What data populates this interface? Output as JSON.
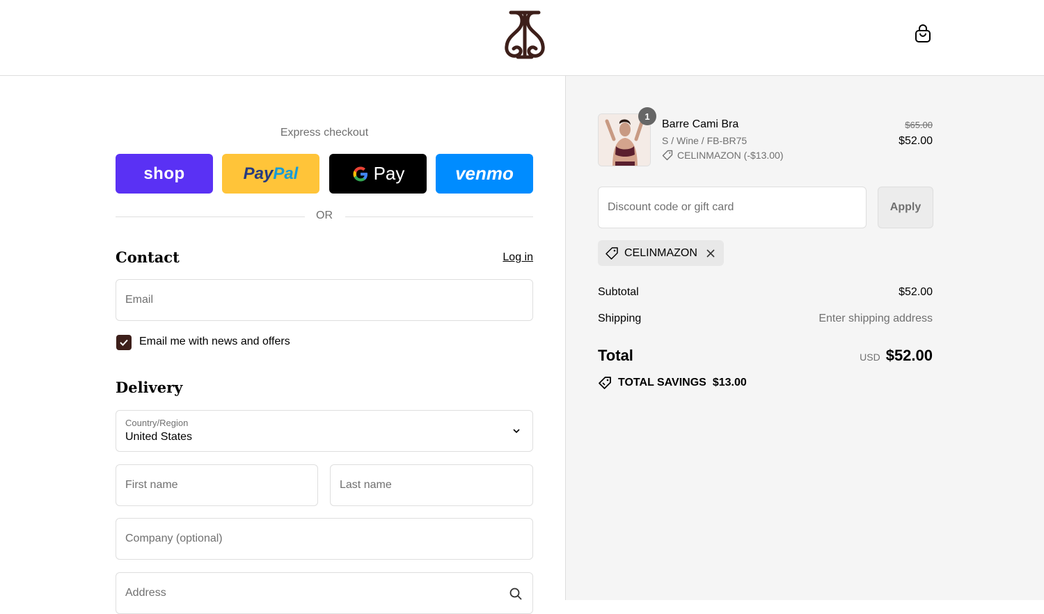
{
  "header": {
    "logo_name": "brand-logo",
    "cart_icon": "shopping-bag-icon"
  },
  "express": {
    "label": "Express checkout",
    "shop_label": "shop",
    "paypal_label_1": "Pay",
    "paypal_label_2": "Pal",
    "gpay_label": "Pay",
    "venmo_label": "venmo",
    "or_label": "OR"
  },
  "contact": {
    "title": "Contact",
    "login_label": "Log in",
    "email_placeholder": "Email",
    "newsletter_label": "Email me with news and offers",
    "newsletter_checked": true
  },
  "delivery": {
    "title": "Delivery",
    "country_label": "Country/Region",
    "country_value": "United States",
    "first_name_placeholder": "First name",
    "last_name_placeholder": "Last name",
    "company_placeholder": "Company (optional)",
    "address_placeholder": "Address"
  },
  "order": {
    "item": {
      "quantity": "1",
      "name": "Barre Cami Bra",
      "variant": "S / Wine / FB-BR75",
      "discount": "CELINMAZON (-$13.00)",
      "price_original": "$65.00",
      "price_final": "$52.00"
    },
    "discount_placeholder": "Discount code or gift card",
    "apply_label": "Apply",
    "applied_code": "CELINMAZON",
    "subtotal_label": "Subtotal",
    "subtotal_value": "$52.00",
    "shipping_label": "Shipping",
    "shipping_value": "Enter shipping address",
    "total_label": "Total",
    "total_currency": "USD",
    "total_value": "$52.00",
    "savings_label": "TOTAL SAVINGS",
    "savings_value": "$13.00"
  },
  "colors": {
    "shop": "#5a31f4",
    "paypal": "#ffc439",
    "gpay": "#000000",
    "venmo": "#008cff",
    "checkbox": "#3d1f1a",
    "brand": "#3d1f1a"
  }
}
